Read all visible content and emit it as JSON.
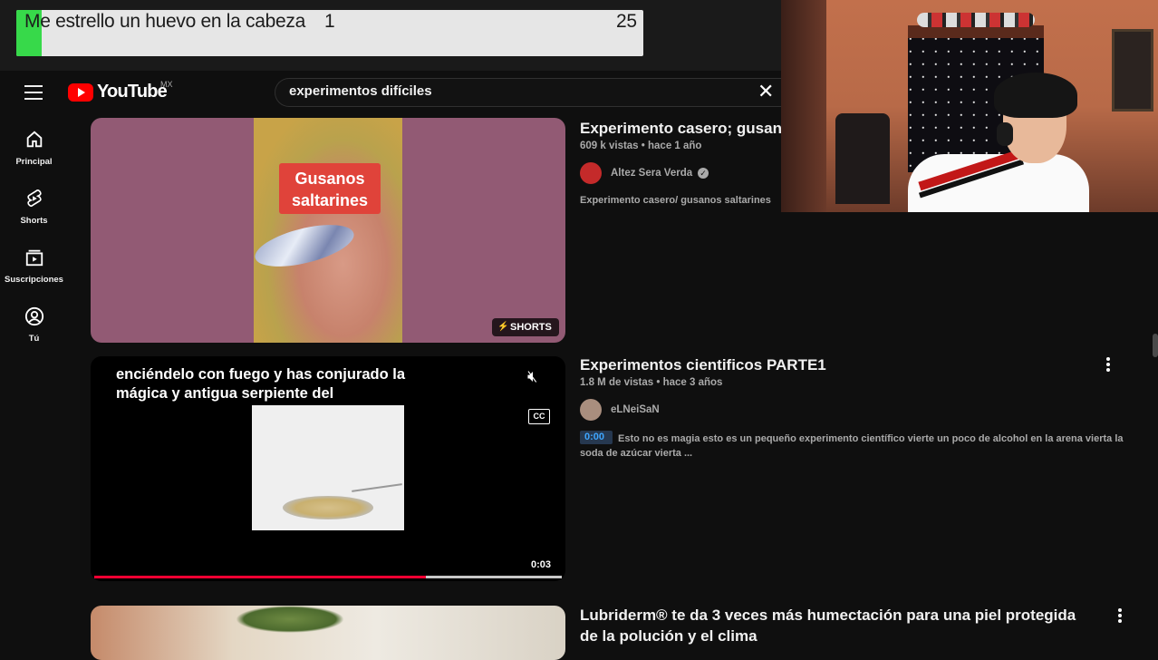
{
  "overlay": {
    "goal_text": "Me estrello un huevo en la cabeza",
    "current": "1",
    "target": "25",
    "progress": 0.04
  },
  "header": {
    "logo_text": "YouTube",
    "country_code": "MX",
    "search_value": "experimentos difíciles",
    "clear_glyph": "✕"
  },
  "sidebar": {
    "items": [
      {
        "label": "Principal",
        "icon": "home-icon"
      },
      {
        "label": "Shorts",
        "icon": "shorts-icon"
      },
      {
        "label": "Suscripciones",
        "icon": "subscriptions-icon"
      },
      {
        "label": "Tú",
        "icon": "you-icon"
      }
    ]
  },
  "results": [
    {
      "thumb_text": "Gusanos\nsaltarines",
      "badge": "SHORTS",
      "title": "Experimento casero; gusan",
      "meta": "609 k vistas • hace 1 año",
      "channel": "Altez Sera Verda",
      "verified": true,
      "description": "Experimento casero/ gusanos saltarines"
    },
    {
      "caption": "enciéndelo con fuego y has conjurado la mágica y antigua serpiente del",
      "duration": "0:03",
      "cc": "CC",
      "play_progress": 0.71,
      "title": "Experimentos cientificos PARTE1",
      "meta": "1.8 M de vistas • hace 3 años",
      "channel": "eLNeiSaN",
      "timestamp": "0:00",
      "description": "Esto no es magia esto es un pequeño experimento científico vierte un poco de alcohol en la arena vierta la soda de azúcar vierta ..."
    },
    {
      "title_line1": "Lubriderm® te da 3 veces más humectación para una piel protegida",
      "title_line2": "de la polución y el clima"
    }
  ],
  "colors": {
    "brand_red": "#ff0000",
    "progress_red": "#ff0033",
    "goal_green": "#37d94a",
    "bg": "#0f0f0f"
  }
}
